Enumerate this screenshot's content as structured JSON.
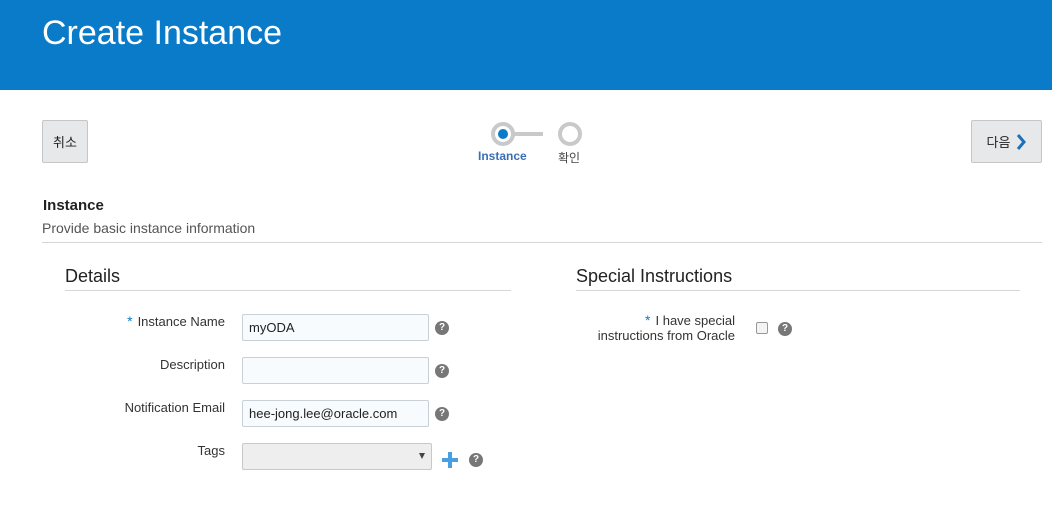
{
  "header": {
    "title": "Create Instance"
  },
  "toolbar": {
    "cancel_label": "취소",
    "next_label": "다음"
  },
  "train": {
    "steps": [
      {
        "label": "Instance",
        "active": true
      },
      {
        "label": "확인",
        "active": false
      }
    ]
  },
  "section": {
    "title": "Instance",
    "subtitle": "Provide basic instance information"
  },
  "details": {
    "title": "Details",
    "required_marker": "*",
    "fields": {
      "instance_name": {
        "label": "Instance Name",
        "value": "myODA",
        "required": true
      },
      "description": {
        "label": "Description",
        "value": ""
      },
      "notification_email": {
        "label": "Notification Email",
        "value": "hee-jong.lee@oracle.com"
      },
      "tags": {
        "label": "Tags",
        "value": ""
      }
    },
    "help_glyph": "?"
  },
  "special": {
    "title": "Special Instructions",
    "required_marker": "*",
    "checkbox_label_line1": "I have special",
    "checkbox_label_line2": "instructions from Oracle",
    "checked": false
  },
  "colors": {
    "header": "#0a7bc9",
    "accent": "#0a7bc9",
    "active_step": "#3a6fb5"
  }
}
